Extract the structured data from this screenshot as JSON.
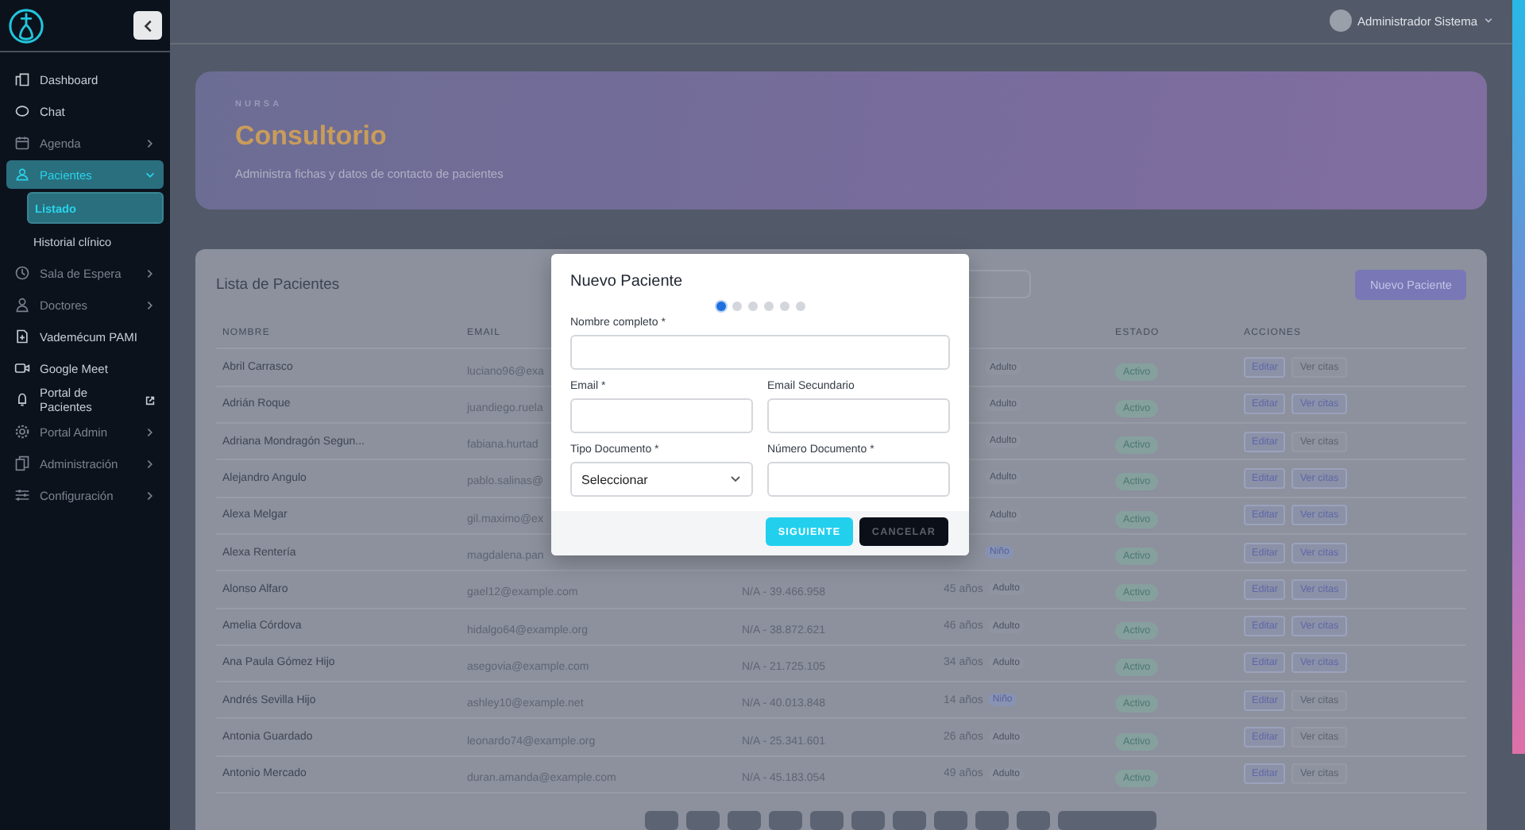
{
  "sidebar": {
    "items": [
      {
        "label": "Dashboard",
        "disabled": false,
        "submenu": false,
        "external": false,
        "selected": false
      },
      {
        "label": "Chat",
        "disabled": false,
        "submenu": false,
        "external": false,
        "selected": false
      },
      {
        "label": "Agenda",
        "disabled": true,
        "submenu": true,
        "external": false,
        "selected": false,
        "expanded": false
      },
      {
        "label": "Pacientes",
        "disabled": false,
        "submenu": true,
        "external": false,
        "selected": true,
        "expanded": true,
        "children": [
          {
            "label": "Listado",
            "selected": true
          },
          {
            "label": "Historial clínico",
            "selected": false
          }
        ]
      },
      {
        "label": "Sala de Espera",
        "disabled": true,
        "submenu": true,
        "external": false,
        "selected": false,
        "expanded": false
      },
      {
        "label": "Doctores",
        "disabled": true,
        "submenu": true,
        "external": false,
        "selected": false,
        "expanded": false
      },
      {
        "label": "Vademécum PAMI",
        "disabled": false,
        "submenu": false,
        "external": false,
        "selected": false
      },
      {
        "label": "Google Meet",
        "disabled": false,
        "submenu": false,
        "external": false,
        "selected": false
      },
      {
        "label": "Portal de Pacientes",
        "disabled": false,
        "submenu": false,
        "external": true,
        "selected": false
      },
      {
        "label": "Portal Admin",
        "disabled": true,
        "submenu": true,
        "external": false,
        "selected": false,
        "expanded": false
      },
      {
        "label": "Administración",
        "disabled": true,
        "submenu": true,
        "external": false,
        "selected": false,
        "expanded": false
      },
      {
        "label": "Configuración",
        "disabled": true,
        "submenu": true,
        "external": false,
        "selected": false,
        "expanded": false
      }
    ]
  },
  "topbar": {
    "user": "Administrador Sistema"
  },
  "hero": {
    "eyebrow": "NURSA",
    "title": "Consultorio",
    "subtitle": "Administra fichas y datos de contacto de pacientes"
  },
  "table": {
    "title": "Lista de Pacientes",
    "new_button": "Nuevo Paciente",
    "columns": [
      "NOMBRE",
      "EMAIL",
      "ESTADO",
      "ACCIONES"
    ],
    "rows": [
      {
        "name": "Abril Carrasco",
        "email": "luciano96@exa",
        "group": {
          "text": "Adulto",
          "kind": "adult"
        },
        "status": "Activo",
        "edit": "Editar",
        "appointments": "Ver citas",
        "appointments_disabled": true
      },
      {
        "name": "Adrián Roque",
        "email": "juandiego.ruela",
        "group": {
          "text": "Adulto",
          "kind": "adult"
        },
        "status": "Activo",
        "edit": "Editar",
        "appointments": "Ver citas",
        "appointments_disabled": false
      },
      {
        "name": "Adriana Mondragón Segun...",
        "email": "fabiana.hurtad",
        "group": {
          "text": "Adulto",
          "kind": "adult"
        },
        "status": "Activo",
        "edit": "Editar",
        "appointments": "Ver citas",
        "appointments_disabled": true
      },
      {
        "name": "Alejandro Angulo",
        "email": "pablo.salinas@",
        "group": {
          "text": "Adulto",
          "kind": "adult"
        },
        "status": "Activo",
        "edit": "Editar",
        "appointments": "Ver citas",
        "appointments_disabled": false
      },
      {
        "name": "Alexa Melgar",
        "email": "gil.maximo@ex",
        "group": {
          "text": "Adulto",
          "kind": "adult"
        },
        "status": "Activo",
        "edit": "Editar",
        "appointments": "Ver citas",
        "appointments_disabled": false
      },
      {
        "name": "Alexa Rentería",
        "email": "magdalena.pan",
        "group": {
          "text": "Niño",
          "kind": "child"
        },
        "status": "Activo",
        "edit": "Editar",
        "appointments": "Ver citas",
        "appointments_disabled": false
      },
      {
        "name": "Alonso Alfaro",
        "email": "gael12@example.com",
        "document": "N/A - 39.466.958",
        "age": "45 años",
        "group": {
          "text": "Adulto",
          "kind": "adult"
        },
        "status": "Activo",
        "edit": "Editar",
        "appointments": "Ver citas",
        "appointments_disabled": false
      },
      {
        "name": "Amelia Córdova",
        "email": "hidalgo64@example.org",
        "document": "N/A - 38.872.621",
        "age": "46 años",
        "group": {
          "text": "Adulto",
          "kind": "adult"
        },
        "status": "Activo",
        "edit": "Editar",
        "appointments": "Ver citas",
        "appointments_disabled": false
      },
      {
        "name": "Ana Paula Gómez Hijo",
        "email": "asegovia@example.com",
        "document": "N/A - 21.725.105",
        "age": "34 años",
        "group": {
          "text": "Adulto",
          "kind": "adult"
        },
        "status": "Activo",
        "edit": "Editar",
        "appointments": "Ver citas",
        "appointments_disabled": false
      },
      {
        "name": "Andrés Sevilla Hijo",
        "email": "ashley10@example.net",
        "document": "N/A - 40.013.848",
        "age": "14 años",
        "group": {
          "text": "Niño",
          "kind": "child"
        },
        "status": "Activo",
        "edit": "Editar",
        "appointments": "Ver citas",
        "appointments_disabled": true
      },
      {
        "name": "Antonia Guardado",
        "email": "leonardo74@example.org",
        "document": "N/A - 25.341.601",
        "age": "26 años",
        "group": {
          "text": "Adulto",
          "kind": "adult"
        },
        "status": "Activo",
        "edit": "Editar",
        "appointments": "Ver citas",
        "appointments_disabled": true
      },
      {
        "name": "Antonio Mercado",
        "email": "duran.amanda@example.com",
        "document": "N/A - 45.183.054",
        "age": "49 años",
        "group": {
          "text": "Adulto",
          "kind": "adult"
        },
        "status": "Activo",
        "edit": "Editar",
        "appointments": "Ver citas",
        "appointments_disabled": true
      }
    ],
    "pagination": [
      {
        "kind": "page"
      },
      {
        "kind": "page"
      },
      {
        "kind": "page"
      },
      {
        "kind": "page"
      },
      {
        "kind": "page"
      },
      {
        "kind": "page"
      },
      {
        "kind": "page"
      },
      {
        "kind": "page"
      },
      {
        "kind": "page"
      },
      {
        "kind": "page"
      },
      {
        "kind": "wide"
      }
    ]
  },
  "modal": {
    "title": "Nuevo Paciente",
    "steps": [
      {
        "selected": true
      },
      {
        "selected": false
      },
      {
        "selected": false
      },
      {
        "selected": false
      },
      {
        "selected": false
      },
      {
        "selected": false
      }
    ],
    "fields": [
      {
        "label": "Nombre completo *",
        "kind": "text"
      },
      {
        "label": "Email *",
        "kind": "text"
      },
      {
        "label": "Email Secundario",
        "kind": "text"
      },
      {
        "label": "Tipo Documento *",
        "kind": "select",
        "value": "Seleccionar"
      },
      {
        "label": "Número Documento *",
        "kind": "text"
      }
    ],
    "primary": "SIGUIENTE",
    "secondary": "CANCELAR"
  }
}
